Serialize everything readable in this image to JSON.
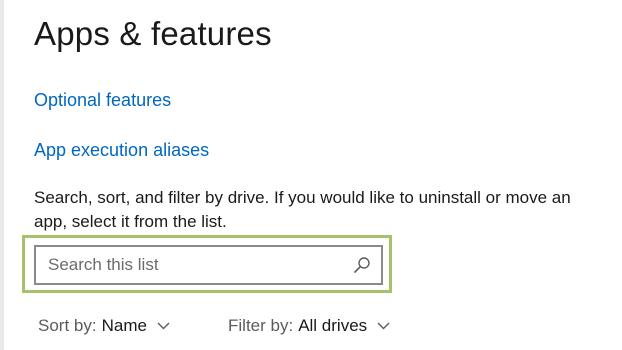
{
  "page": {
    "title": "Apps & features"
  },
  "links": {
    "optional_features": "Optional features",
    "app_execution_aliases": "App execution aliases"
  },
  "description": "Search, sort, and filter by drive. If you would like to uninstall or move an app, select it from the list.",
  "search": {
    "placeholder": "Search this list",
    "value": "",
    "icon": "search-icon"
  },
  "sort": {
    "label": "Sort by:",
    "value": "Name",
    "icon": "chevron-down-icon"
  },
  "filter": {
    "label": "Filter by:",
    "value": "All drives",
    "icon": "chevron-down-icon"
  },
  "colors": {
    "link": "#0067c0",
    "highlight": "#a4c26a",
    "input_border": "#8a8a8a"
  }
}
